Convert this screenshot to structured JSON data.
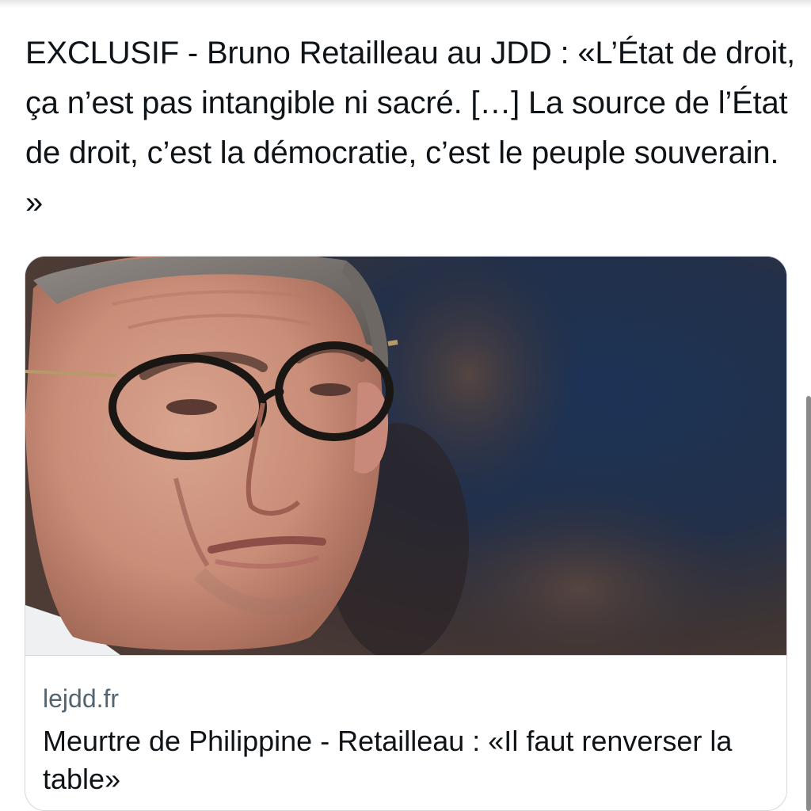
{
  "tweet": {
    "text": "EXCLUSIF - Bruno Retailleau au JDD : «L’État de droit, ça n’est pas intangible ni sacré. […] La source de l’État de droit, c’est la démocratie, c’est le peuple souverain. »"
  },
  "link_card": {
    "image_description_icon": "photo-of-man-with-glasses",
    "domain": "lejdd.fr",
    "headline": "Meurtre de Philippine - Retailleau : «Il faut renverser la table»"
  },
  "colors": {
    "text_primary": "#0f1419",
    "text_secondary": "#536471",
    "card_border": "#cfd9de"
  }
}
